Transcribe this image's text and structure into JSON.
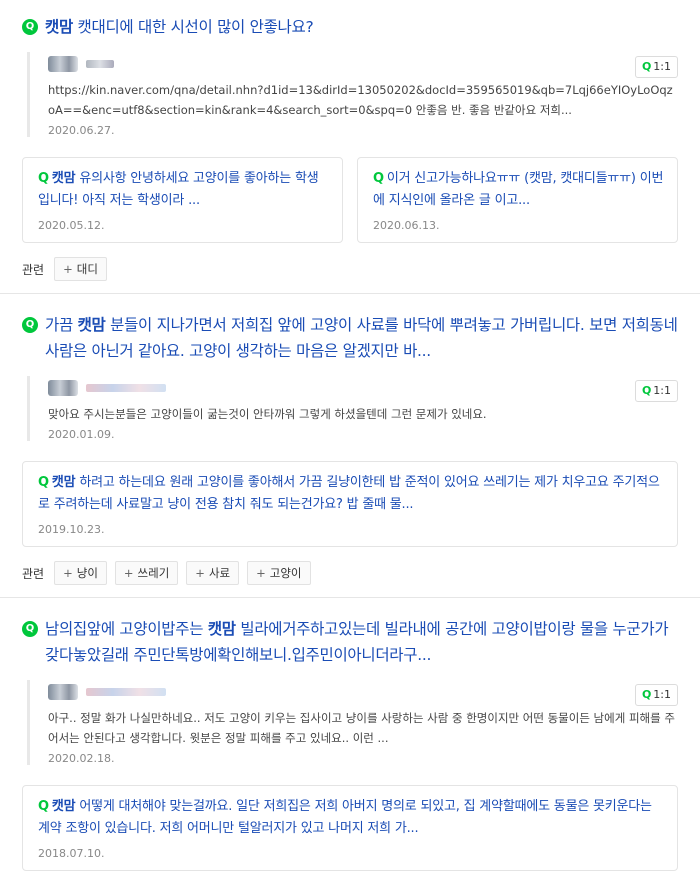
{
  "items": [
    {
      "title_kw": "캣맘",
      "title_rest": " 캣대디에 대한 시선이 많이 안좋나요?",
      "answer_ratio": "1:1",
      "answer_text": "https://kin.naver.com/qna/detail.nhn?d1id=13&dirId=13050202&docId=359565019&qb=7Lqj66eYIOyLoOqzoA==&enc=utf8&section=kin&rank=4&search_sort=0&spq=0 안좋음 반. 좋음 반같아요 저희...",
      "answer_date": "2020.06.27.",
      "cards": [
        {
          "kw": "캣맘",
          "text": " 유의사항 안녕하세요 고양이를 좋아하는 학생입니다! 아직 저는 학생이라 ...",
          "date": "2020.05.12."
        },
        {
          "kw": "",
          "text": "이거 신고가능하나요ㅠㅠ (캣맘, 캣대디들ㅠㅠ) 이번에 지식인에 올라온 글 이고...",
          "date": "2020.06.13."
        }
      ],
      "related_label": "관련",
      "tags": [
        "대디"
      ]
    },
    {
      "title_pre": "가끔 ",
      "title_kw": "캣맘",
      "title_rest": " 분들이 지나가면서 저희집 앞에 고양이 사료를 바닥에 뿌려놓고 가버립니다. 보면 저희동네 사람은 아닌거 같아요. 고양이 생각하는 마음은 알겠지만 바...",
      "answer_ratio": "1:1",
      "answer_text": "맞아요 주시는분들은 고양이들이 굶는것이 안타까워 그렇게 하셨을텐데 그런 문제가 있네요.",
      "answer_date": "2020.01.09.",
      "cards": [
        {
          "kw": "캣맘",
          "text": " 하려고 하는데요 원래 고양이를 좋아해서 가끔 길냥이한테 밥 준적이 있어요 쓰레기는 제가 치우고요 주기적으로 주려하는데 사료말고 냥이 전용 참치 줘도 되는건가요? 밥 줄때 물...",
          "date": "2019.10.23."
        }
      ],
      "related_label": "관련",
      "tags": [
        "냥이",
        "쓰레기",
        "사료",
        "고양이"
      ]
    },
    {
      "title_pre": "남의집앞에 고양이밥주는 ",
      "title_kw": "캣맘",
      "title_rest": " 빌라에거주하고있는데 빌라내에 공간에 고양이밥이랑 물을 누군가가갖다놓았길래 주민단톡방에확인해보니.입주민이아니더라구...",
      "answer_ratio": "1:1",
      "answer_text": "아구.. 정말 화가 나실만하네요.. 저도 고양이 키우는 집사이고 냥이를 사랑하는 사람 중 한명이지만 어떤 동물이든 남에게 피해를 주어서는 안된다고 생각합니다. 윗분은 정말 피해를 주고 있네요.. 이런 ...",
      "answer_date": "2020.02.18.",
      "cards": [
        {
          "kw": "캣맘",
          "text": " 어떻게 대처해야 맞는걸까요. 일단 저희집은 저희 아버지 명의로 되있고, 집 계약할때에도 동물은 못키운다는 계약 조항이 있습니다. 저희 어머니만 털알러지가 있고 나머지 저희 가...",
          "date": "2018.07.10."
        }
      ]
    }
  ],
  "q_glyph": "Q",
  "plus_glyph": "+"
}
